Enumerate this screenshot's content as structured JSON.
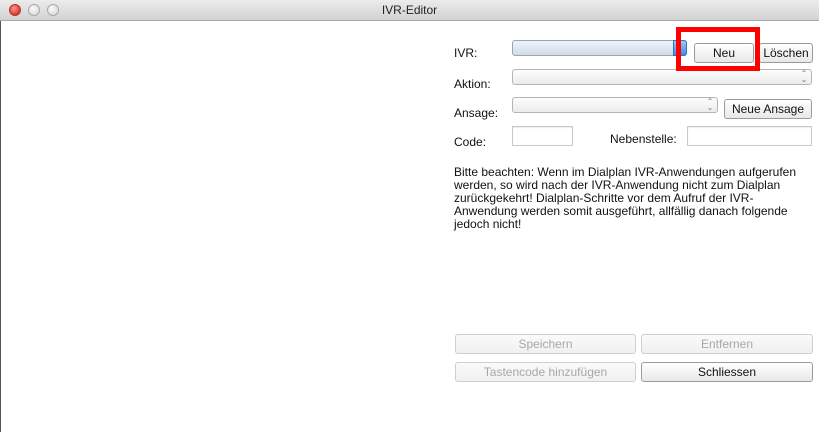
{
  "window": {
    "title": "IVR-Editor"
  },
  "form": {
    "ivr_label": "IVR:",
    "aktion_label": "Aktion:",
    "ansage_label": "Ansage:",
    "code_label": "Code:",
    "nebenstelle_label": "Nebenstelle:",
    "ivr_value": "",
    "aktion_value": "",
    "ansage_value": "",
    "code_value": "",
    "nebenstelle_value": ""
  },
  "buttons": {
    "neu": "Neu",
    "loeschen": "Löschen",
    "neue_ansage": "Neue Ansage",
    "speichern": "Speichern",
    "entfernen": "Entfernen",
    "tastencode": "Tastencode hinzufügen",
    "schliessen": "Schliessen"
  },
  "note": "Bitte beachten: Wenn im Dialplan IVR-Anwendungen aufgerufen werden, so wird nach der IVR-Anwendung nicht zum Dialplan zurückgekehrt! Dialplan-Schritte vor dem Aufruf der IVR-Anwendung werden somit ausgeführt, allfällig danach folgende jedoch nicht!",
  "colors": {
    "highlight": "#ff0000"
  }
}
